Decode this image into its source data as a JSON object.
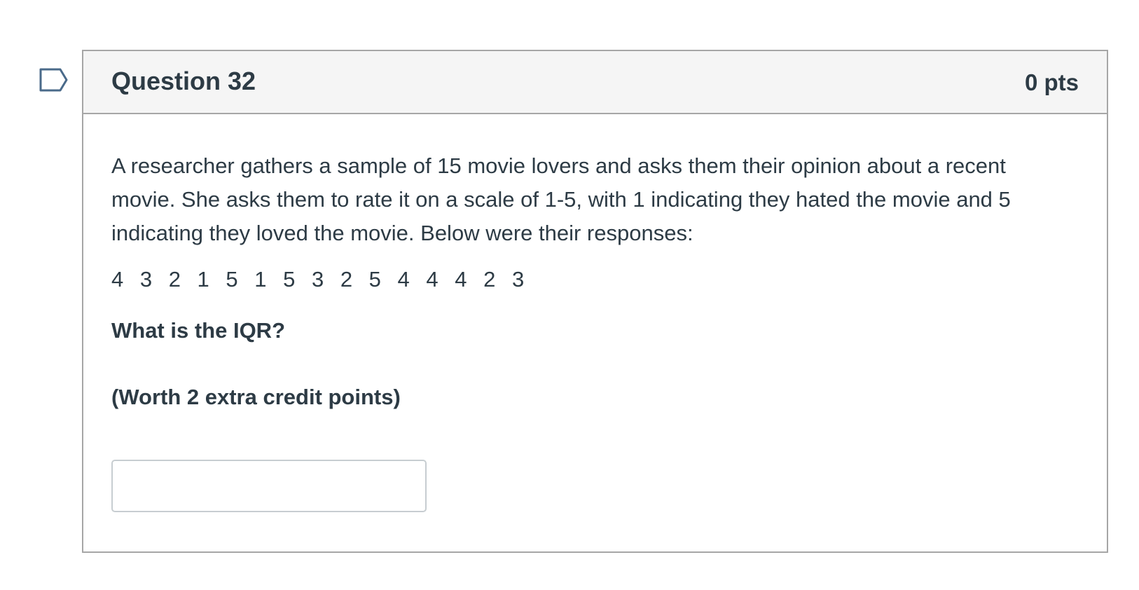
{
  "question": {
    "title": "Question 32",
    "points": "0 pts",
    "flag_icon": "flag-outline-icon",
    "body": {
      "prompt": "A researcher gathers a sample of 15 movie lovers and asks them their opinion about a recent movie. She asks them to rate it on a scale of 1-5, with 1 indicating they hated the movie and 5 indicating they loved the movie. Below were their responses:",
      "responses": "4 3 2 1 5 1 5 3 2 5 4 4 4 2 3",
      "ask": "What is the IQR?",
      "extra_credit": "(Worth 2 extra credit points)"
    },
    "answer": {
      "value": "",
      "placeholder": ""
    }
  },
  "colors": {
    "text": "#2d3b45",
    "header_bg": "#f5f5f5",
    "border": "#a6a6a6",
    "flag_stroke": "#4a6a8a"
  }
}
